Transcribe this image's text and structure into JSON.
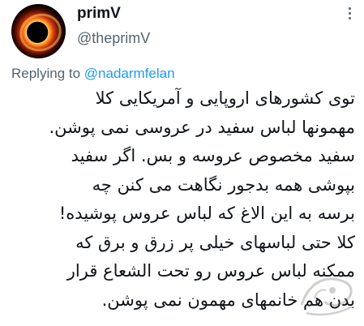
{
  "tweet": {
    "author": {
      "display_name": "primV",
      "handle": "@theprimV",
      "avatar_icon": "black-hole-avatar"
    },
    "more_icon": "more-vertical-icon",
    "replying_prefix": "Replying to",
    "replying_handle": "@nadarmfelan",
    "text_lines": [
      "توی کشورهای اروپایی و آمریکایی کلا",
      "مهمونها لباس سفید در عروسی نمی پوشن.",
      "سفید مخصوص عروسه و بس. اگر سفید",
      "بپوشی همه بدجور نگاهت می کنن چه",
      "برسه به این الاغ که لباس عروس پوشیده!",
      "کلا حتی لباسهای خیلی پر زرق و برق که",
      "ممکنه لباس عروس رو تحت الشعاع قرار",
      "بدن هم خانمهای مهمون نمی پوشن."
    ],
    "colors": {
      "text": "#0f1419",
      "secondary": "#536471",
      "accent": "#1d9bf0"
    }
  }
}
